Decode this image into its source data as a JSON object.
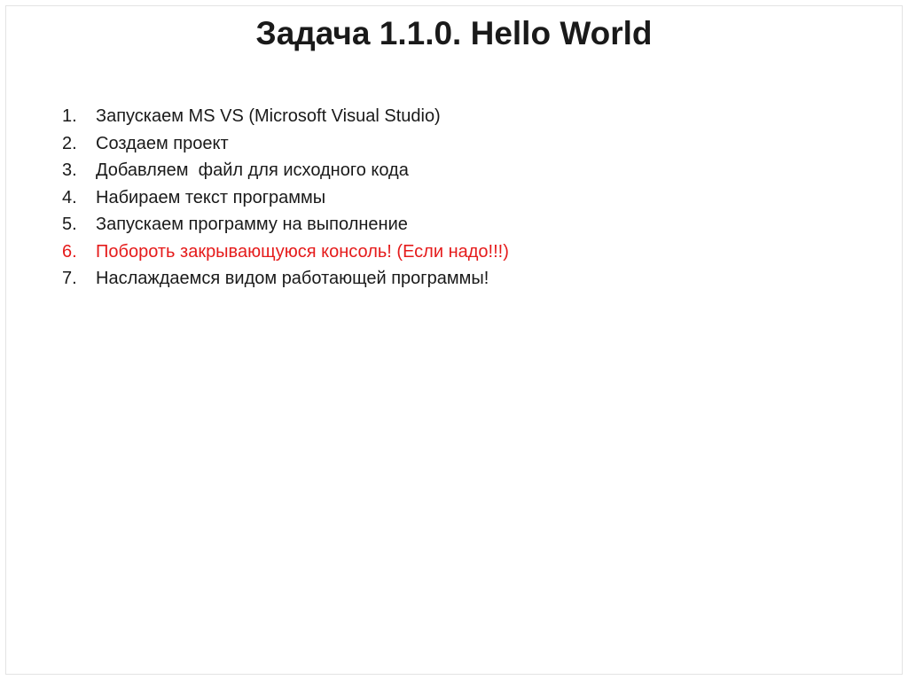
{
  "slide": {
    "title": "Задача 1.1.0. Hello World",
    "accent_color": "#e51b1b",
    "text_color": "#1a1a1a",
    "steps": [
      {
        "num": "1.",
        "text": "Запускаем MS VS (Microsoft Visual Studio)"
      },
      {
        "num": "2.",
        "text": "Создаем проект"
      },
      {
        "num": "3.",
        "text": "Добавляем  файл для исходного кода"
      },
      {
        "num": "4.",
        "text": "Набираем текст программы"
      },
      {
        "num": "5.",
        "text": "Запускаем программу на выполнение"
      },
      {
        "num": "6.",
        "text": "Побороть закрывающуюся консоль! (Если надо!!!)"
      },
      {
        "num": "7.",
        "text": "Наслаждаемся видом работающей программы!"
      }
    ]
  }
}
